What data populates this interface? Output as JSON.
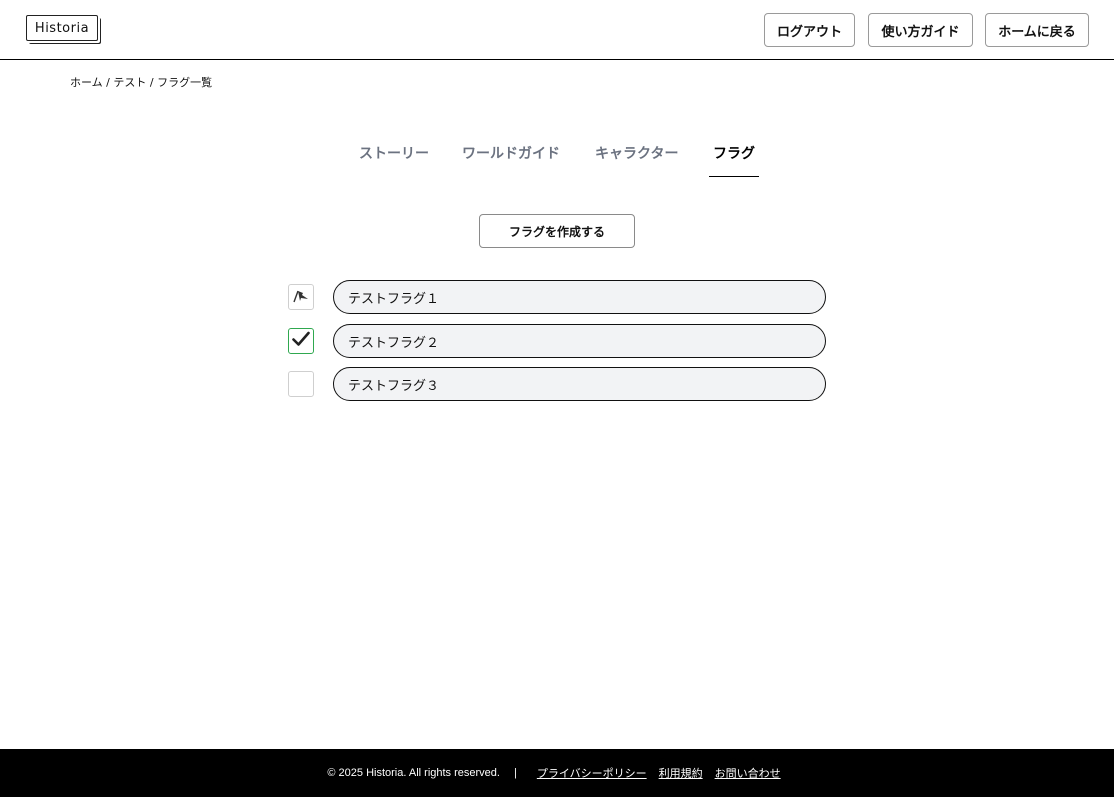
{
  "header": {
    "logo_text": "Historia",
    "buttons": {
      "logout": "ログアウト",
      "guide": "使い方ガイド",
      "home": "ホームに戻る"
    }
  },
  "breadcrumb": "ホーム / テスト / フラグ一覧",
  "tabs": [
    {
      "label": "ストーリー",
      "active": false
    },
    {
      "label": "ワールドガイド",
      "active": false
    },
    {
      "label": "キャラクター",
      "active": false
    },
    {
      "label": "フラグ",
      "active": true
    }
  ],
  "create_button": "フラグを作成する",
  "flags": [
    {
      "name": "テストフラグ１",
      "state": "flag",
      "icon": "flag-icon"
    },
    {
      "name": "テストフラグ２",
      "state": "checked",
      "icon": "check-icon"
    },
    {
      "name": "テストフラグ３",
      "state": "empty",
      "icon": ""
    }
  ],
  "footer": {
    "copyright": "© 2025 Historia. All rights reserved.",
    "separator": "|",
    "links": [
      "プライバシーポリシー",
      "利用規約",
      "お問い合わせ"
    ]
  },
  "colors": {
    "tab_inactive": "#6b7280",
    "pill_bg": "#f2f3f5",
    "check_border": "#2fa84f",
    "footer_bg": "#000000"
  }
}
